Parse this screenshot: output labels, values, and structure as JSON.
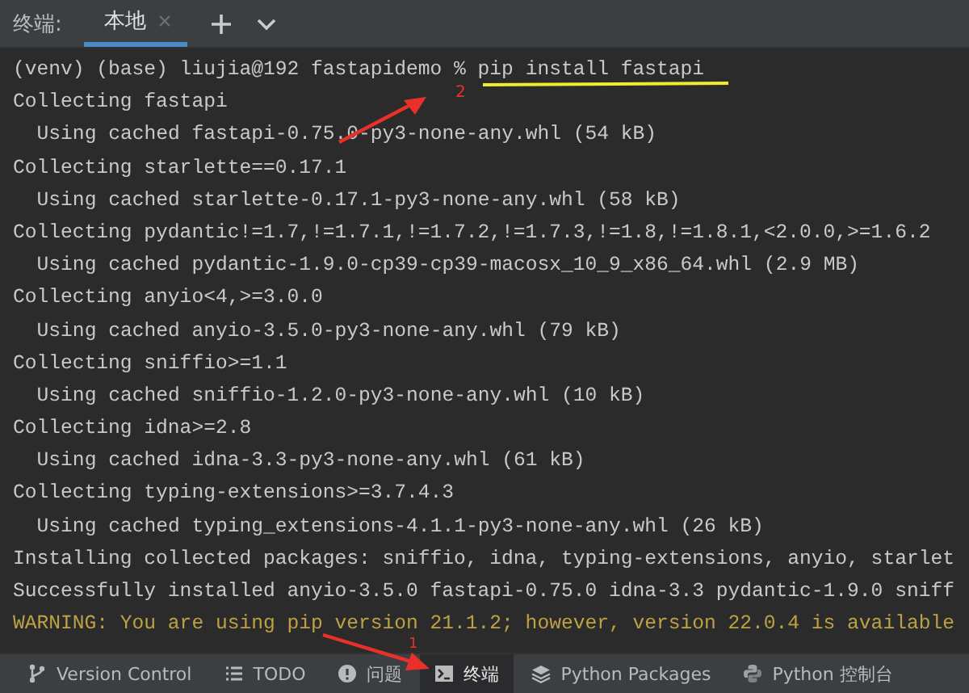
{
  "header": {
    "label": "终端:",
    "tabs": [
      {
        "label": "本地",
        "selected": true
      }
    ]
  },
  "lines": [
    {
      "kind": "command",
      "prompt": "(venv) (base) liujia@192 fastapidemo % ",
      "text": "pip install fastapi"
    },
    {
      "kind": "output",
      "text": "Collecting fastapi"
    },
    {
      "kind": "detail",
      "text": "Using cached fastapi-0.75.0-py3-none-any.whl (54 kB)"
    },
    {
      "kind": "output",
      "text": "Collecting starlette==0.17.1"
    },
    {
      "kind": "detail",
      "text": "Using cached starlette-0.17.1-py3-none-any.whl (58 kB)"
    },
    {
      "kind": "output",
      "text": "Collecting pydantic!=1.7,!=1.7.1,!=1.7.2,!=1.7.3,!=1.8,!=1.8.1,<2.0.0,>=1.6.2"
    },
    {
      "kind": "detail",
      "text": "Using cached pydantic-1.9.0-cp39-cp39-macosx_10_9_x86_64.whl (2.9 MB)"
    },
    {
      "kind": "output",
      "text": "Collecting anyio<4,>=3.0.0"
    },
    {
      "kind": "detail",
      "text": "Using cached anyio-3.5.0-py3-none-any.whl (79 kB)"
    },
    {
      "kind": "output",
      "text": "Collecting sniffio>=1.1"
    },
    {
      "kind": "detail",
      "text": "Using cached sniffio-1.2.0-py3-none-any.whl (10 kB)"
    },
    {
      "kind": "output",
      "text": "Collecting idna>=2.8"
    },
    {
      "kind": "detail",
      "text": "Using cached idna-3.3-py3-none-any.whl (61 kB)"
    },
    {
      "kind": "output",
      "text": "Collecting typing-extensions>=3.7.4.3"
    },
    {
      "kind": "detail",
      "text": "Using cached typing_extensions-4.1.1-py3-none-any.whl (26 kB)"
    },
    {
      "kind": "output",
      "text": "Installing collected packages: sniffio, idna, typing-extensions, anyio, starlet"
    },
    {
      "kind": "output",
      "text": "Successfully installed anyio-3.5.0 fastapi-0.75.0 idna-3.3 pydantic-1.9.0 sniff"
    },
    {
      "kind": "warning",
      "text": "WARNING: You are using pip version 21.1.2; however, version 22.0.4 is available"
    }
  ],
  "annotations": [
    {
      "kind": "arrow-up",
      "label": "2"
    },
    {
      "kind": "arrow-down",
      "label": "1"
    }
  ],
  "toolbar": [
    {
      "kind": "branch",
      "label": "Version Control",
      "selected": false
    },
    {
      "kind": "list",
      "label": "TODO",
      "selected": false
    },
    {
      "kind": "info",
      "label": "问题",
      "selected": false
    },
    {
      "kind": "terminal",
      "label": "终端",
      "selected": true
    },
    {
      "kind": "layers",
      "label": "Python Packages",
      "selected": false
    },
    {
      "kind": "python",
      "label": "Python 控制台",
      "selected": false
    }
  ]
}
